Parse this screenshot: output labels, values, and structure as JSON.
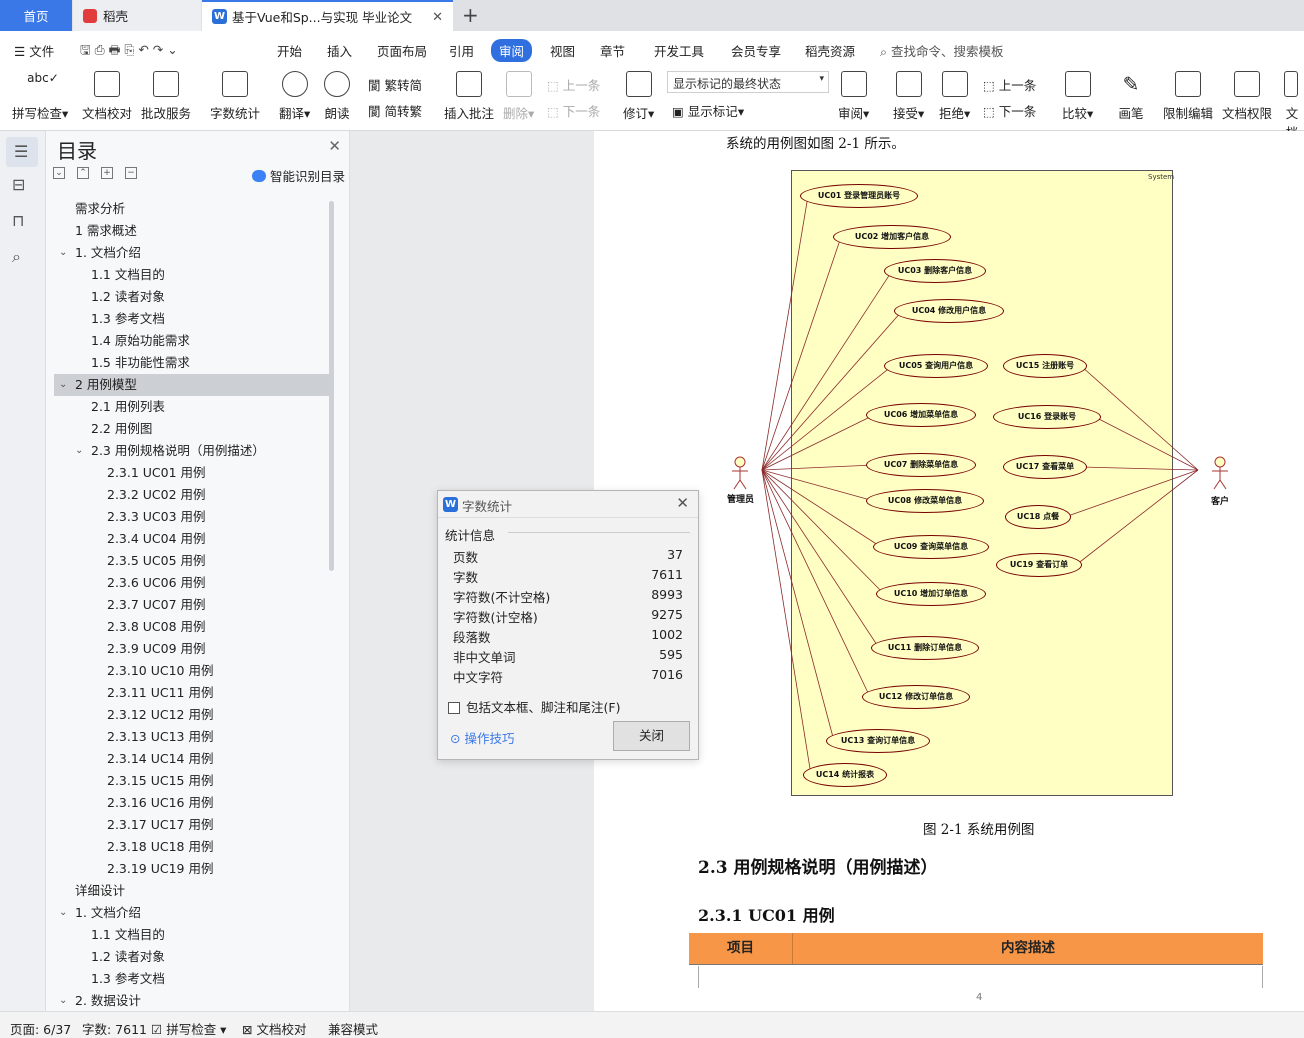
{
  "tabs": {
    "home": "首页",
    "daoke": "稻壳",
    "doc": "基于Vue和Sp...与实现 毕业论文"
  },
  "menu": {
    "file": "文件",
    "items": [
      "开始",
      "插入",
      "页面布局",
      "引用",
      "审阅",
      "视图",
      "章节",
      "开发工具",
      "会员专享",
      "稻壳资源"
    ],
    "active": "审阅",
    "search": "查找命令、搜索模板"
  },
  "toolbar": {
    "spellcheck": "拼写检查",
    "doccheck": "文档校对",
    "batch": "批改服务",
    "wordcount": "字数统计",
    "translate": "翻译",
    "read": "朗读",
    "trad": "繁转简",
    "simp": "简转繁",
    "insert_comment": "插入批注",
    "delete": "删除",
    "prev": "上一条",
    "next": "下一条",
    "revise": "修订",
    "markup_state": "显示标记的最终状态",
    "show_markup": "显示标记",
    "review": "审阅",
    "accept": "接受",
    "reject": "拒绝",
    "prev2": "上一条",
    "next2": "下一条",
    "compare": "比较",
    "pen": "画笔",
    "restrict": "限制编辑",
    "permission": "文档权限",
    "doc_more": "文档"
  },
  "sidebar": {
    "title": "目录",
    "smart": "智能识别目录",
    "items": [
      {
        "t": "需求分析",
        "lvl": 0
      },
      {
        "t": "1  需求概述",
        "lvl": 0
      },
      {
        "t": "1. 文档介绍",
        "lvl": 0,
        "exp": true
      },
      {
        "t": "1.1  文档目的",
        "lvl": 1
      },
      {
        "t": "1.2  读者对象",
        "lvl": 1
      },
      {
        "t": "1.3  参考文档",
        "lvl": 1
      },
      {
        "t": "1.4  原始功能需求",
        "lvl": 1
      },
      {
        "t": "1.5  非功能性需求",
        "lvl": 1
      },
      {
        "t": "2  用例模型",
        "lvl": 0,
        "exp": true,
        "sel": true
      },
      {
        "t": "2.1  用例列表",
        "lvl": 1
      },
      {
        "t": "2.2  用例图",
        "lvl": 1
      },
      {
        "t": "2.3  用例规格说明（用例描述）",
        "lvl": 1,
        "exp": true
      },
      {
        "t": "2.3.1 UC01 用例",
        "lvl": 2
      },
      {
        "t": "2.3.2 UC02 用例",
        "lvl": 2
      },
      {
        "t": "2.3.3 UC03 用例",
        "lvl": 2
      },
      {
        "t": "2.3.4 UC04 用例",
        "lvl": 2
      },
      {
        "t": "2.3.5 UC05 用例",
        "lvl": 2
      },
      {
        "t": "2.3.6 UC06 用例",
        "lvl": 2
      },
      {
        "t": "2.3.7 UC07 用例",
        "lvl": 2
      },
      {
        "t": "2.3.8 UC08 用例",
        "lvl": 2
      },
      {
        "t": "2.3.9 UC09 用例",
        "lvl": 2
      },
      {
        "t": "2.3.10 UC10 用例",
        "lvl": 2
      },
      {
        "t": "2.3.11 UC11 用例",
        "lvl": 2
      },
      {
        "t": "2.3.12 UC12 用例",
        "lvl": 2
      },
      {
        "t": "2.3.13 UC13 用例",
        "lvl": 2
      },
      {
        "t": "2.3.14 UC14 用例",
        "lvl": 2
      },
      {
        "t": "2.3.15 UC15 用例",
        "lvl": 2
      },
      {
        "t": "2.3.16 UC16 用例",
        "lvl": 2
      },
      {
        "t": "2.3.17 UC17 用例",
        "lvl": 2
      },
      {
        "t": "2.3.18 UC18 用例",
        "lvl": 2
      },
      {
        "t": "2.3.19 UC19 用例",
        "lvl": 2
      },
      {
        "t": "详细设计",
        "lvl": 0
      },
      {
        "t": "1. 文档介绍",
        "lvl": 0,
        "exp": true
      },
      {
        "t": "1.1  文档目的",
        "lvl": 1
      },
      {
        "t": "1.2  读者对象",
        "lvl": 1
      },
      {
        "t": "1.3  参考文档",
        "lvl": 1
      },
      {
        "t": "2. 数据设计",
        "lvl": 0,
        "exp": true
      }
    ]
  },
  "doc": {
    "intro": "系统的用例图如图 2-1 所示。",
    "system": "System",
    "admin": "管理员",
    "customer": "客户",
    "usecases": [
      "UC01 登录管理员账号",
      "UC02 增加客户信息",
      "UC03 删除客户信息",
      "UC04 修改用户信息",
      "UC05 查询用户信息",
      "UC06 增加菜单信息",
      "UC07 删除菜单信息",
      "UC08 修改菜单信息",
      "UC09 查询菜单信息",
      "UC10 增加订单信息",
      "UC11 删除订单信息",
      "UC12 修改订单信息",
      "UC13 查询订单信息",
      "UC14 统计报表",
      "UC15 注册账号",
      "UC16 登录账号",
      "UC17 查看菜单",
      "UC18 点餐",
      "UC19 查看订单"
    ],
    "caption": "图 2-1  系统用例图",
    "h2": "2.3  用例规格说明（用例描述）",
    "h3": "2.3.1 UC01 用例",
    "col1": "项目",
    "col2": "内容描述",
    "page": "4"
  },
  "dialog": {
    "title": "字数统计",
    "section": "统计信息",
    "rows": [
      [
        "页数",
        "37"
      ],
      [
        "字数",
        "7611"
      ],
      [
        "字符数(不计空格)",
        "8993"
      ],
      [
        "字符数(计空格)",
        "9275"
      ],
      [
        "段落数",
        "1002"
      ],
      [
        "非中文单词",
        "595"
      ],
      [
        "中文字符",
        "7016"
      ]
    ],
    "include": "包括文本框、脚注和尾注(F)",
    "tips": "操作技巧",
    "close": "关闭"
  },
  "status": {
    "page": "页面: 6/37",
    "words": "字数: 7611",
    "spell": "拼写检查",
    "check": "文档校对",
    "compat": "兼容模式"
  },
  "colors": {
    "accent": "#2f6fe0",
    "table_header": "#f79646",
    "uml_bg": "#ffffc4"
  }
}
